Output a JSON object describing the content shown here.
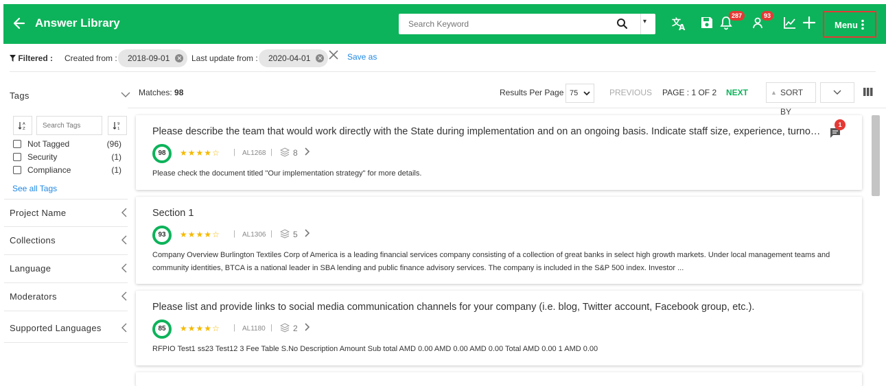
{
  "header": {
    "title": "Answer Library",
    "search_placeholder": "Search Keyword",
    "notifications_count": "287",
    "users_count": "93",
    "menu_label": "Menu"
  },
  "filters": {
    "label": "Filtered :",
    "created_label": "Created from :",
    "created_value": "2018-09-01",
    "updated_label": "Last update from :",
    "updated_value": "2020-04-01",
    "save_as": "Save as"
  },
  "sidebar": {
    "tags_title": "Tags",
    "search_tags_placeholder": "Search Tags",
    "tags": [
      {
        "label": "Not Tagged",
        "count": "(96)"
      },
      {
        "label": "Security",
        "count": "(1)"
      },
      {
        "label": "Compliance",
        "count": "(1)"
      }
    ],
    "see_all": "See all Tags",
    "sections": [
      "Project Name",
      "Collections",
      "Language",
      "Moderators",
      "Supported Languages"
    ]
  },
  "results": {
    "matches_label": "Matches:",
    "matches_count": "98",
    "per_page_label": "Results Per Page",
    "per_page_value": "75",
    "previous": "PREVIOUS",
    "page": "PAGE : 1 OF 2",
    "next": "NEXT",
    "sort_by": "SORT BY"
  },
  "cards": [
    {
      "question": "Please describe the team that would work directly with the State during implementation and on an ongoing basis. Indicate staff size, experience, turnover and location.",
      "score": "98",
      "rating": 4,
      "id": "AL1268",
      "layers": "8",
      "comments": "1",
      "answer": "Please check the document titled \"Our implementation strategy\" for more details."
    },
    {
      "question": "Section 1",
      "score": "93",
      "rating": 4,
      "id": "AL1306",
      "layers": "5",
      "answer": "Company Overview Burlington Textiles Corp of America is a leading financial services company consisting of a collection of great banks in select high growth markets. Under local management teams and community identities, BTCA is a national leader in SBA lending and public finance advisory services. The company is included in the S&P 500 index. Investor ..."
    },
    {
      "question": "Please list and provide links to social media communication channels for your company (i.e. blog, Twitter account, Facebook group, etc.).",
      "score": "85",
      "rating": 4,
      "id": "AL1180",
      "layers": "2",
      "answer": "RFPIO Test1 ss23 Test12 3 Fee Table S.No Description Amount Sub total AMD 0.00 AMD 0.00 AMD 0.00 Total AMD 0.00 1 AMD 0.00"
    }
  ],
  "colors": {
    "brand": "#0db35a",
    "badge": "#e53935",
    "link": "#1e88e5",
    "star": "#f5b900"
  }
}
